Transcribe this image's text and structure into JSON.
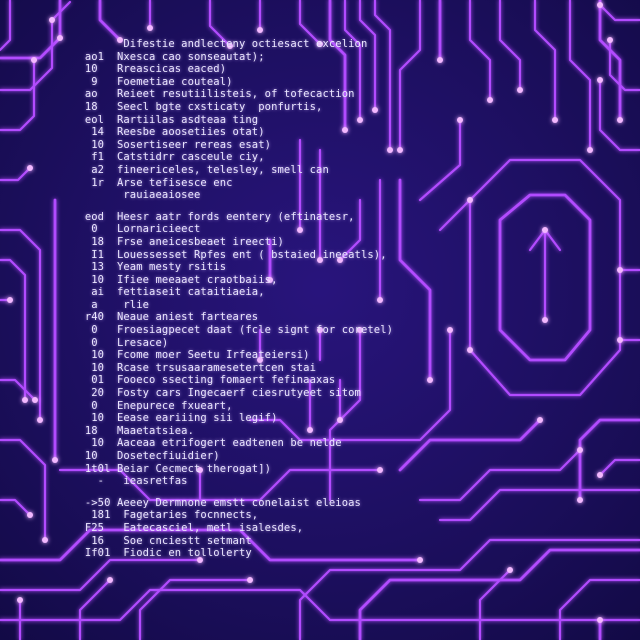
{
  "colors": {
    "background": "#1a0f5c",
    "trace": "#b24bff",
    "trace_glow": "#e08cff",
    "node": "#f3b8ff",
    "text": "#eae6ff"
  },
  "code_lines": [
    "        Difestie andlecteny octiesact excelion",
    "  ao1  Nxesca cao sonseautat);",
    "  10   Rreascicas eaced)",
    "   9   Foemetiae couteal)",
    "  ao   Reieet resutiilisteis, of tofecaction",
    "  18   Seecl bgte cxsticaty  ponfurtis,",
    "  eol  Rartiilas asdteaa ting",
    "   14  Reesbe aoosetiies otat)",
    "   10  Sosertiseer rereas esat)",
    "   f1  Catstidrr casceule ciy,",
    "   a2  fineericeles, telesley, smell can",
    "   1r  Arse tefisesce enc",
    "        rauiaeaiosee",
    "",
    "  eod  Heesr aatr fords eentery (eftinatesr,",
    "   0   Lornaricieect",
    "   18  Frse aneicesbeaet ireecti)",
    "   I1  Louessesset Rpfes ent ( bstaied ineeatls),",
    "   13  Yeam mesty rsitis",
    "   10  Ifiee meeaaet craotbaiis,",
    "   ai  fettiaseit cataitiaeia,",
    "   a    rlie",
    "  r40  Neaue aniest farteares",
    "   0   Froesiagpecet daat (fcle signt for coretel)",
    "   0   Lresace)",
    "   10  Fcome moer Seetu Irfeateiersi)",
    "   10  Rcase trsusaaramesetertcen stai",
    "   01  Fooeco ssecting fomaert fefinaaxas",
    "   20  Fosty cars Ingecaerf ciesrutyeet sitom",
    "   0   Enepurece fxueart,",
    "   10  Eease eariiing sii legif)",
    "  18   Maaetatsiea.",
    "   10  Aaceaa etrifogert eadtenen be nelde",
    "  10   Dosetecfiuidier)",
    "  1t0l Beiar Cecmect therogat])",
    "    -   ieasretfas",
    "",
    "  ->50 Aeeey Dermnone emstt conelaist eleioas",
    "   181  Fagetaries focnnects,",
    "  F25   Eatecasciel, metl isalesdes,",
    "   16   Soe cnciestt setmant",
    "  If01  Fiodic en tollolerty"
  ]
}
